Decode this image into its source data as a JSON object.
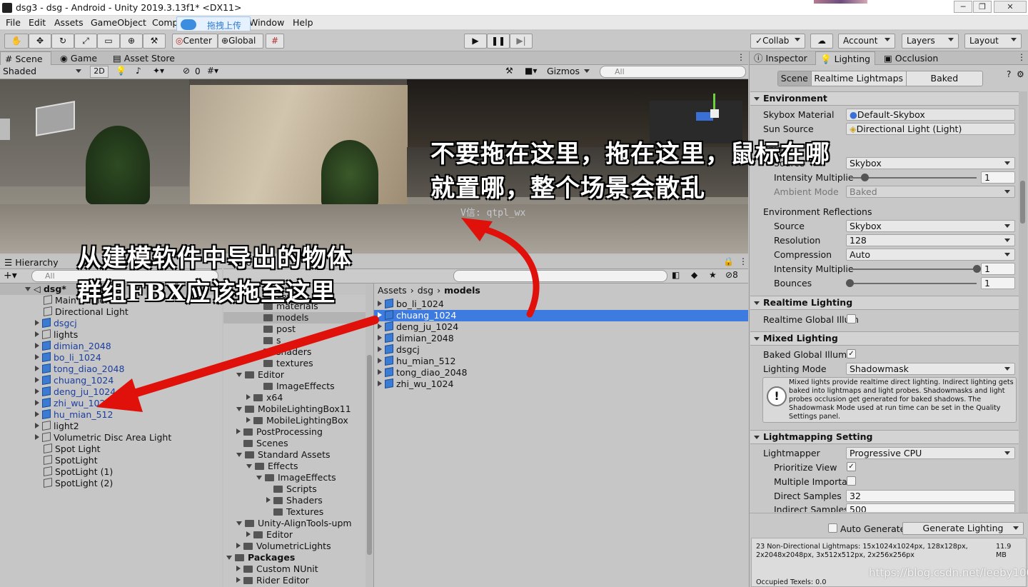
{
  "window": {
    "title": "dsg3 - dsg - Android - Unity 2019.3.13f1* <DX11>",
    "minimize": "─",
    "maximize": "❐",
    "close": "✕"
  },
  "menu": [
    "File",
    "Edit",
    "Assets",
    "GameObject",
    "Comp",
    "Window",
    "Help"
  ],
  "baidu_badge": {
    "label": "拖拽上传"
  },
  "toolbar": {
    "center": "Center",
    "global": "Global",
    "collab": "Collab",
    "account": "Account",
    "layers": "Layers",
    "layout": "Layout"
  },
  "scene_panel": {
    "tabs": [
      "Scene",
      "Game",
      "Asset Store"
    ],
    "shading": "Shaded",
    "mode2d": "2D",
    "hidden_count": "0",
    "gizmos": "Gizmos",
    "search_placeholder": "All",
    "watermark": "V信: qtpl_wx"
  },
  "hierarchy": {
    "tab": "Hierarchy",
    "search_placeholder": "All",
    "root": "dsg*",
    "items": [
      {
        "label": "Main Camera",
        "blue": false,
        "expand": false
      },
      {
        "label": "Directional Light",
        "blue": false,
        "expand": false
      },
      {
        "label": "dsgcj",
        "blue": true,
        "expand": true
      },
      {
        "label": "lights",
        "blue": false,
        "expand": true
      },
      {
        "label": "dimian_2048",
        "blue": true,
        "expand": true
      },
      {
        "label": "bo_li_1024",
        "blue": true,
        "expand": true
      },
      {
        "label": "tong_diao_2048",
        "blue": true,
        "expand": true
      },
      {
        "label": "chuang_1024",
        "blue": true,
        "expand": true
      },
      {
        "label": "deng_ju_1024",
        "blue": true,
        "expand": true
      },
      {
        "label": "zhi_wu_1024",
        "blue": true,
        "expand": true
      },
      {
        "label": "hu_mian_512",
        "blue": true,
        "expand": true
      },
      {
        "label": "light2",
        "blue": false,
        "expand": true
      },
      {
        "label": "Volumetric Disc Area Light",
        "blue": false,
        "expand": true
      },
      {
        "label": "Spot Light",
        "blue": false,
        "expand": false
      },
      {
        "label": "SpotLight",
        "blue": false,
        "expand": false
      },
      {
        "label": "SpotLight (1)",
        "blue": false,
        "expand": false
      },
      {
        "label": "SpotLight (2)",
        "blue": false,
        "expand": false
      }
    ]
  },
  "project": {
    "tab": "Proj",
    "hidden_count": "8",
    "breadcrumb": [
      "Assets",
      "dsg",
      "models"
    ],
    "tree": [
      {
        "label": "dsg",
        "indent": 3,
        "arrow": "none"
      },
      {
        "label": "materials",
        "indent": 3,
        "arrow": "none"
      },
      {
        "label": "models",
        "indent": 3,
        "arrow": "none",
        "selected": true
      },
      {
        "label": "post",
        "indent": 3,
        "arrow": "none"
      },
      {
        "label": "s",
        "indent": 3,
        "arrow": "none"
      },
      {
        "label": "shaders",
        "indent": 3,
        "arrow": "none"
      },
      {
        "label": "textures",
        "indent": 3,
        "arrow": "none"
      },
      {
        "label": "Editor",
        "indent": 1,
        "arrow": "down"
      },
      {
        "label": "ImageEffects",
        "indent": 3,
        "arrow": "none"
      },
      {
        "label": "x64",
        "indent": 2,
        "arrow": "right"
      },
      {
        "label": "MobileLightingBox11",
        "indent": 1,
        "arrow": "down"
      },
      {
        "label": "MobileLightingBox",
        "indent": 2,
        "arrow": "right"
      },
      {
        "label": "PostProcessing",
        "indent": 1,
        "arrow": "right"
      },
      {
        "label": "Scenes",
        "indent": 1,
        "arrow": "none"
      },
      {
        "label": "Standard Assets",
        "indent": 1,
        "arrow": "down"
      },
      {
        "label": "Effects",
        "indent": 2,
        "arrow": "down"
      },
      {
        "label": "ImageEffects",
        "indent": 3,
        "arrow": "down"
      },
      {
        "label": "Scripts",
        "indent": 4,
        "arrow": "none"
      },
      {
        "label": "Shaders",
        "indent": 4,
        "arrow": "right"
      },
      {
        "label": "Textures",
        "indent": 4,
        "arrow": "none"
      },
      {
        "label": "Unity-AlignTools-upm",
        "indent": 1,
        "arrow": "down"
      },
      {
        "label": "Editor",
        "indent": 2,
        "arrow": "right"
      },
      {
        "label": "VolumetricLights",
        "indent": 1,
        "arrow": "right"
      },
      {
        "label": "Packages",
        "indent": 0,
        "arrow": "down",
        "bold": true
      },
      {
        "label": "Custom NUnit",
        "indent": 1,
        "arrow": "right"
      },
      {
        "label": "Rider Editor",
        "indent": 1,
        "arrow": "right"
      }
    ],
    "assets": [
      {
        "label": "bo_li_1024"
      },
      {
        "label": "chuang_1024",
        "selected": true
      },
      {
        "label": "deng_ju_1024"
      },
      {
        "label": "dimian_2048"
      },
      {
        "label": "dsgcj"
      },
      {
        "label": "hu_mian_512"
      },
      {
        "label": "tong_diao_2048"
      },
      {
        "label": "zhi_wu_1024"
      }
    ]
  },
  "inspector": {
    "tabs": [
      "Inspector",
      "Lighting",
      "Occlusion"
    ],
    "subtabs": [
      "Scene",
      "Realtime Lightmaps",
      "Baked Lightmaps"
    ],
    "environment": {
      "header": "Environment",
      "skybox_label": "Skybox Material",
      "skybox_value": "Default-Skybox",
      "sun_label": "Sun Source",
      "sun_value": "Directional Light (Light)",
      "env_light_label": "Envi",
      "source_label": "Source",
      "source_value": "Skybox",
      "intensity_label": "Intensity Multiplie",
      "intensity_value": "1",
      "intensity_fraction": 0.12,
      "ambient_label": "Ambient Mode",
      "ambient_value": "Baked",
      "refl_label": "Environment Reflections",
      "refl_source_label": "Source",
      "refl_source_value": "Skybox",
      "resolution_label": "Resolution",
      "resolution_value": "128",
      "compression_label": "Compression",
      "compression_value": "Auto",
      "refl_intensity_label": "Intensity Multiplie",
      "refl_intensity_value": "1",
      "refl_intensity_fraction": 1.0,
      "bounces_label": "Bounces",
      "bounces_value": "1",
      "bounces_fraction": 0.0
    },
    "realtime": {
      "header": "Realtime Lighting",
      "gi_label": "Realtime Global Illum"
    },
    "mixed": {
      "header": "Mixed Lighting",
      "baked_gi_label": "Baked Global Illumin",
      "mode_label": "Lighting Mode",
      "mode_value": "Shadowmask",
      "help": "Mixed lights provide realtime direct lighting. Indirect lighting gets baked into lightmaps and light probes. Shadowmasks and light probes occlusion get generated for baked shadows. The Shadowmask Mode used at run time can be set in the Quality Settings panel."
    },
    "lightmapping": {
      "header": "Lightmapping Setting",
      "lightmapper_label": "Lightmapper",
      "lightmapper_value": "Progressive CPU",
      "prioritize_label": "Prioritize View",
      "multiple_label": "Multiple Importan",
      "direct_label": "Direct Samples",
      "direct_value": "32",
      "indirect_label": "Indirect Samples",
      "indirect_value": "500"
    },
    "auto_generate_label": "Auto Generate",
    "generate_label": "Generate Lighting",
    "stats": "23 Non-Directional Lightmaps: 15x1024x1024px, 128x128px, 2x2048x2048px, 3x512x512px, 2x256x256px",
    "stats_size": "11.9\nMB",
    "occupied": "Occupied Texels: 0.0"
  },
  "annotations": {
    "top_line1": "不要拖在这里，拖在这里，鼠标在哪",
    "top_line2": "就置哪，整个场景会散乱",
    "left_line1": "从建模软件中导出的物体",
    "left_line2": "群组FBX应该拖至这里"
  },
  "footer_watermark": "https://blog.csdn.net/leeby100",
  "colors": {
    "selection": "#3d7be0",
    "arrow_red": "#e0100a"
  }
}
